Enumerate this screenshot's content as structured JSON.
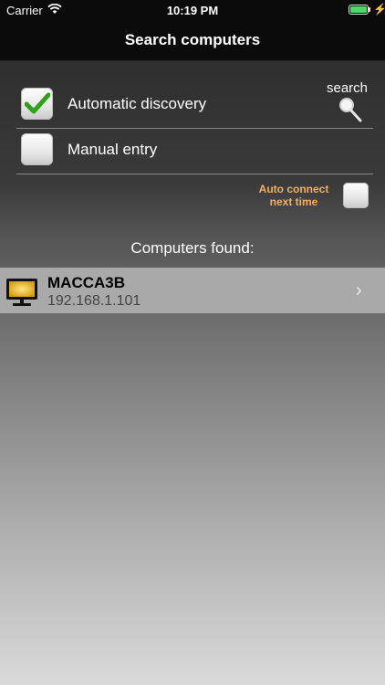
{
  "status_bar": {
    "carrier": "Carrier",
    "time": "10:19 PM",
    "battery_color": "#4cd964"
  },
  "nav": {
    "title": "Search computers"
  },
  "discovery": {
    "automatic": {
      "label": "Automatic discovery",
      "checked": true
    },
    "manual": {
      "label": "Manual entry",
      "checked": false
    }
  },
  "search": {
    "label": "search",
    "icon": "magnifier-icon"
  },
  "auto_connect": {
    "label_line1": "Auto connect",
    "label_line2": "next time",
    "checked": false,
    "color": "#f0b060"
  },
  "computers": {
    "header": "Computers found:",
    "items": [
      {
        "name": "MACCA3B",
        "ip": "192.168.1.101",
        "icon": "monitor-icon"
      }
    ]
  }
}
